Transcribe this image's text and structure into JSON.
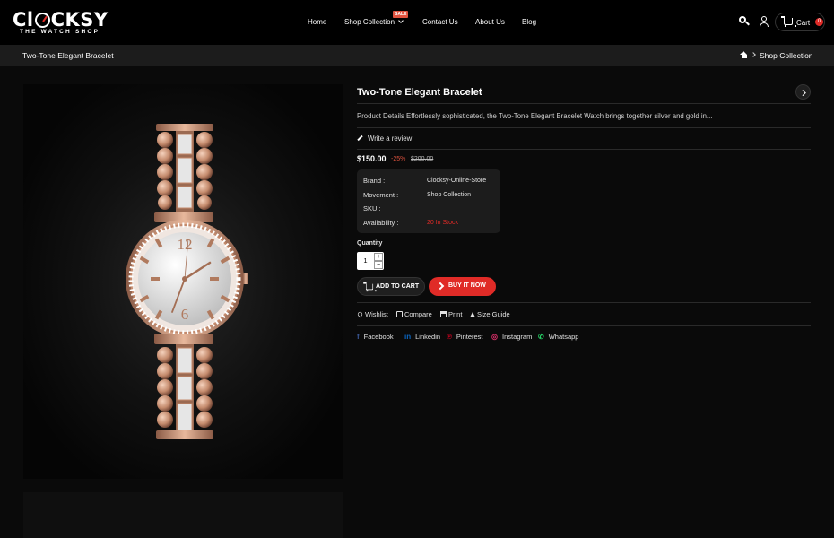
{
  "brand": {
    "logo_main_left": "Cl",
    "logo_main_right": "CKSY",
    "logo_sub": "THE WATCH SHOP"
  },
  "nav": {
    "items": [
      "Home",
      "Shop Collection",
      "Contact Us",
      "About Us",
      "Blog"
    ],
    "sale_badge": "SALE"
  },
  "header": {
    "cart_label": "Cart",
    "cart_count": "0",
    "icons": [
      "search-icon",
      "user-icon",
      "cart-icon"
    ]
  },
  "breadcrumb": {
    "title": "Two-Tone Elegant Bracelet",
    "trail": "Shop Collection"
  },
  "product": {
    "title": "Two-Tone Elegant Bracelet",
    "description": "Product Details Effortlessly sophisticated, the Two-Tone Elegant Bracelet Watch brings together silver and gold in...",
    "review_label": "Write a review",
    "price": "$150.00",
    "discount": "-25%",
    "old_price": "$200.00",
    "specs": [
      {
        "label": "Brand :",
        "value": "Clocksy-Online-Store"
      },
      {
        "label": "Movement :",
        "value": "Shop Collection"
      },
      {
        "label": "SKU :",
        "value": ""
      },
      {
        "label": "Availability :",
        "value": "20 In Stock"
      }
    ],
    "quantity_label": "Quantity",
    "quantity": "1",
    "add_to_cart": "ADD TO CART",
    "buy_now": "BUY IT NOW",
    "actions": [
      "Wishlist",
      "Compare",
      "Print",
      "Size Guide"
    ],
    "social": [
      "Facebook",
      "Linkedin",
      "Pinterest",
      "Instagram",
      "Whatsapp"
    ],
    "watch_numerals": [
      "12",
      "6"
    ]
  },
  "colors": {
    "accent": "#e02b27",
    "header_bg": "#000000",
    "page_bg": "#0a0a0a",
    "rose_gold": "#c9957a"
  }
}
